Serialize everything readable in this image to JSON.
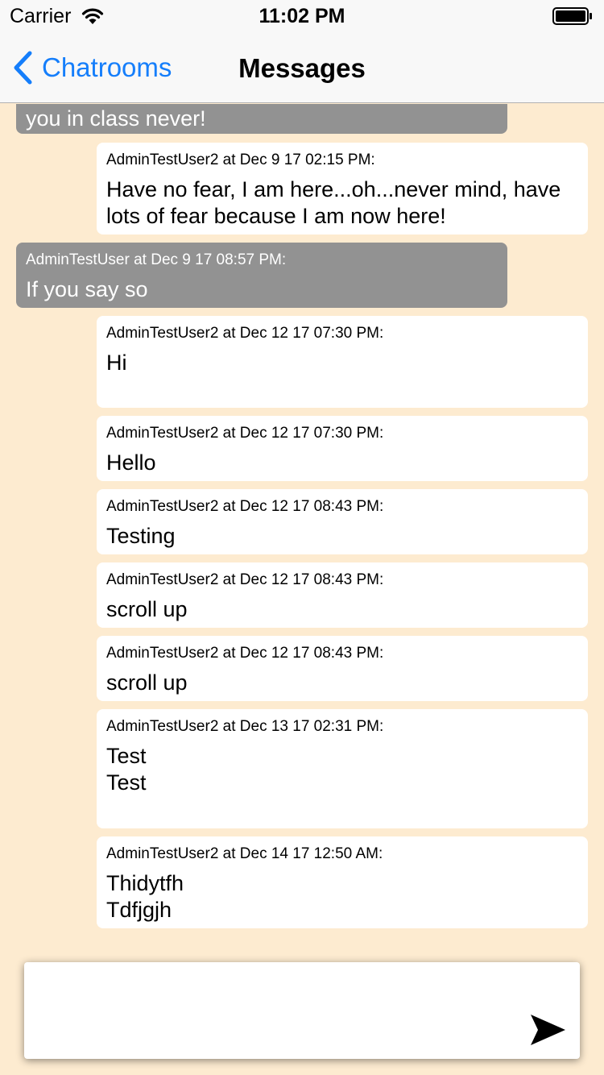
{
  "status_bar": {
    "carrier": "Carrier",
    "time": "11:02 PM",
    "icons": [
      "wifi-icon",
      "battery-icon"
    ]
  },
  "nav": {
    "back_label": "Chatrooms",
    "back_icon": "chevron-left-icon",
    "title": "Messages",
    "accent_color": "#157EFB"
  },
  "colors": {
    "background": "#FDEBD0",
    "incoming_bubble": "#929292",
    "outgoing_bubble": "#FFFFFF"
  },
  "messages": [
    {
      "partial_text": "you in class never!"
    },
    {
      "meta": "AdminTestUser2 at Dec 9 17 02:15 PM:",
      "text": "Have no fear, I am here...oh...never mind, have lots of fear because I am now here!"
    },
    {
      "meta": "AdminTestUser at Dec 9 17 08:57 PM:",
      "text": "If you say so"
    },
    {
      "meta": "AdminTestUser2 at Dec 12 17 07:30 PM:",
      "text": "Hi"
    },
    {
      "meta": "AdminTestUser2 at Dec 12 17 07:30 PM:",
      "text": "Hello"
    },
    {
      "meta": "AdminTestUser2 at Dec 12 17 08:43 PM:",
      "text": "Testing"
    },
    {
      "meta": "AdminTestUser2 at Dec 12 17 08:43 PM:",
      "text": "scroll up"
    },
    {
      "meta": "AdminTestUser2 at Dec 12 17 08:43 PM:",
      "text": "scroll up"
    },
    {
      "meta": "AdminTestUser2 at Dec 13 17 02:31 PM:",
      "text": "Test\nTest"
    },
    {
      "meta": "AdminTestUser2 at Dec 14 17 12:50 AM:",
      "text": "Thidytfh\nTdfjgjh"
    }
  ],
  "composer": {
    "value": "",
    "send_icon": "send-icon"
  }
}
